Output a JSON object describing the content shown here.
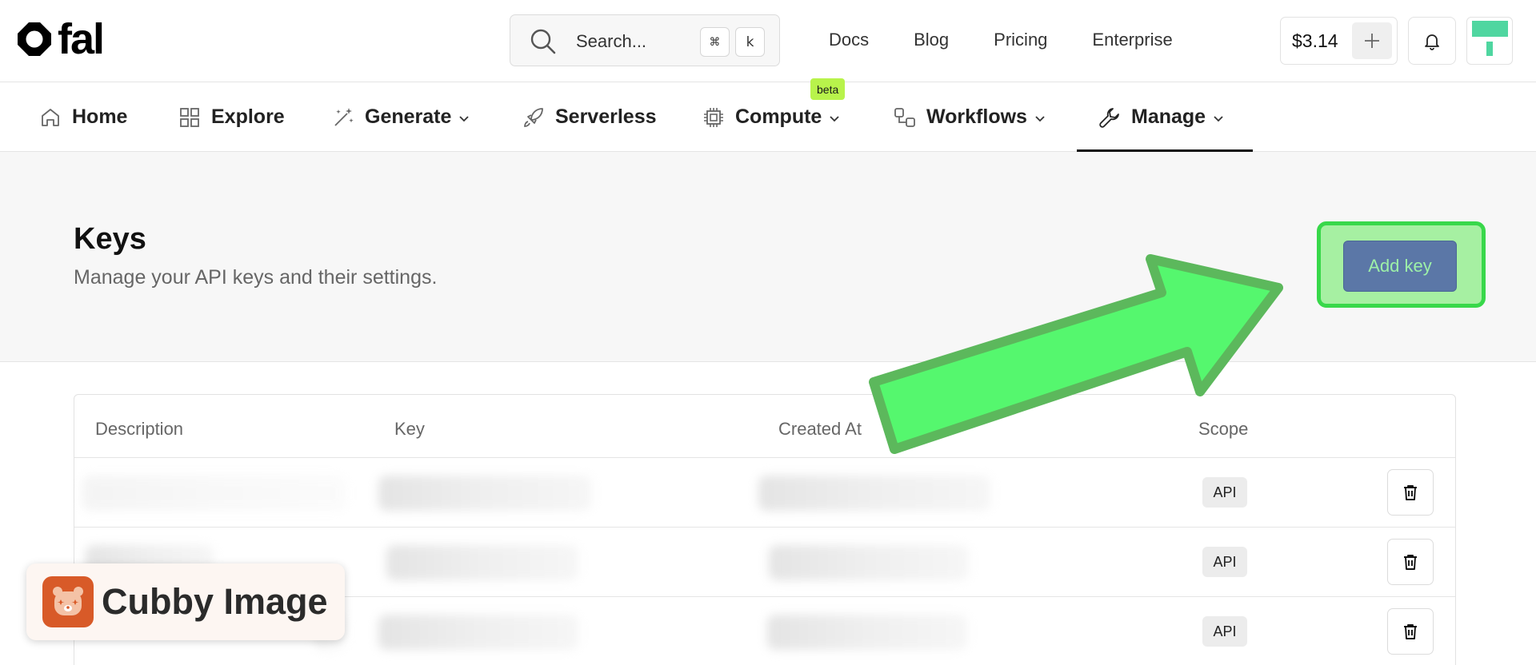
{
  "brand": {
    "logo_text": "fal"
  },
  "search": {
    "placeholder": "Search...",
    "shortcut_modifier": "⌘",
    "shortcut_key": "k"
  },
  "top_links": [
    "Docs",
    "Blog",
    "Pricing",
    "Enterprise"
  ],
  "account": {
    "credits": "$3.14",
    "add_credits_icon": "plus-icon",
    "notifications_icon": "bell-icon"
  },
  "nav": {
    "items": [
      {
        "label": "Home",
        "icon": "home-icon"
      },
      {
        "label": "Explore",
        "icon": "grid-icon"
      },
      {
        "label": "Generate",
        "icon": "wand-icon",
        "dropdown": true
      },
      {
        "label": "Serverless",
        "icon": "rocket-icon"
      },
      {
        "label": "Compute",
        "icon": "cpu-icon",
        "dropdown": true,
        "badge": "beta"
      },
      {
        "label": "Workflows",
        "icon": "workflow-icon",
        "dropdown": true
      },
      {
        "label": "Manage",
        "icon": "wrench-icon",
        "dropdown": true,
        "active": true
      }
    ]
  },
  "page": {
    "title": "Keys",
    "subtitle": "Manage your API keys and their settings.",
    "add_key_label": "Add key"
  },
  "table": {
    "headers": [
      "Description",
      "Key",
      "Created At",
      "Scope"
    ],
    "rows": [
      {
        "description": "",
        "key": "",
        "created_at": "",
        "scope": "API"
      },
      {
        "description": "",
        "key": "",
        "created_at": "",
        "scope": "API"
      },
      {
        "description": "",
        "key": "",
        "created_at": "",
        "scope": "API"
      }
    ]
  },
  "annotation": {
    "arrow_color": "#55f76e",
    "highlight_color": "#38d84a"
  },
  "watermark": {
    "text": "Cubby Image"
  }
}
